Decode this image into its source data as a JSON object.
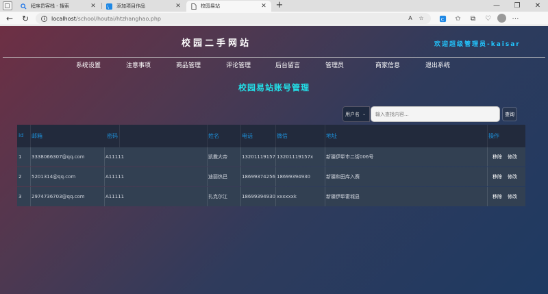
{
  "browser": {
    "tabs": [
      {
        "title": "程序员客栈 - 搜索",
        "icon": "search-icon",
        "active": false
      },
      {
        "title": "添加项目作品",
        "icon": "site-logo-icon",
        "active": false
      },
      {
        "title": "校园易站",
        "icon": "page-icon",
        "active": true
      }
    ],
    "url_host": "localhost",
    "url_path": "/school/houtai/htzhanghao.php"
  },
  "site": {
    "title": "校园二手网站",
    "welcome": "欢迎超级管理员-kaisar"
  },
  "nav": [
    "系统设置",
    "注意事项",
    "商品管理",
    "评论管理",
    "后台留言",
    "管理员",
    "商家信息",
    "退出系统"
  ],
  "page": {
    "heading": "校园易站账号管理"
  },
  "search": {
    "field_selected": "用户名",
    "placeholder": "输入查找内容...",
    "button_label": "查询"
  },
  "table": {
    "headers": [
      "id",
      "邮箱",
      "密码",
      "姓名",
      "电话",
      "微信",
      "地址",
      "操作"
    ],
    "rows": [
      {
        "id": "1",
        "email": "3338066307@qq.com",
        "password": "A11111",
        "name": "凯撒大帝",
        "phone": "13201119157",
        "wechat": "13201119157x",
        "address": "新疆伊犁市二街006号"
      },
      {
        "id": "2",
        "email": "5201314@qq.com",
        "password": "A11111",
        "name": "迪丽热巴",
        "phone": "18699374256",
        "wechat": "18699394930",
        "address": "新疆和田库入赛"
      },
      {
        "id": "3",
        "email": "2974736703@qq.com",
        "password": "A11111",
        "name": "扎克尔江",
        "phone": "18699394930",
        "wechat": "xxxxxxk",
        "address": "新疆伊犁霍城县"
      }
    ],
    "row_actions": {
      "remove": "移除",
      "edit": "修改"
    }
  }
}
